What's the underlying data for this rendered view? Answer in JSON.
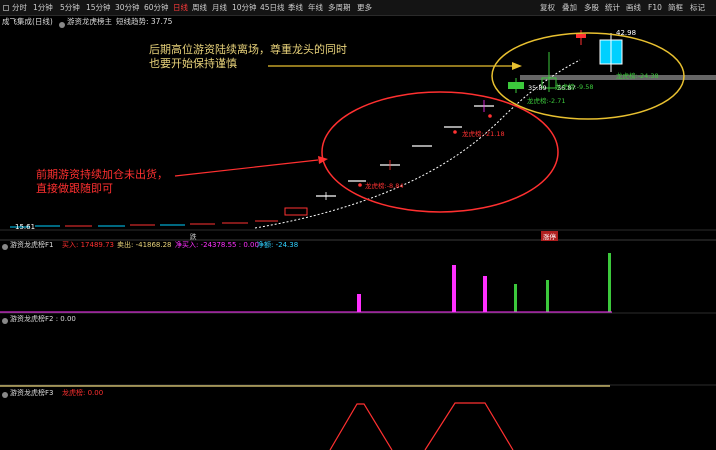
{
  "toolbar": {
    "periods": [
      "分时",
      "1分钟",
      "5分钟",
      "15分钟",
      "30分钟",
      "60分钟",
      "日线",
      "周线",
      "月线",
      "10分钟",
      "45日线",
      "季线",
      "年线",
      "多周期",
      "更多"
    ],
    "active_period": "日线",
    "right_buttons": [
      "复权",
      "叠加",
      "多股",
      "统计",
      "画线",
      "F10",
      "简框",
      "标记"
    ]
  },
  "info": {
    "stock": "成飞集成(日线)",
    "indicator": "游资龙虎榜主",
    "short_trend": "短线趋势: 37.75"
  },
  "main_chart": {
    "annotation_top_line1": "后期高位游资陆续离场，尊重龙头的同时",
    "annotation_top_line2": "也要开始保持谨慎",
    "annotation_left_line1": "前期游资持续加仓未出货，",
    "annotation_left_line2": "直接做跟随即可",
    "price_high": "42.98",
    "price_low": "35.89",
    "price_low2": "36.87",
    "label_left_price": "15.61",
    "dragon_label": "龙虎榜",
    "dragon_values": [
      "-8.84",
      "-21.18",
      "-24.38",
      "-9.58",
      "-2.71"
    ],
    "dragon_labels_full": [
      "龙虎榜:-8.84",
      "龙虎榜:-21.18",
      "龙虎榜:-24.38",
      "龙虎榜:-9.58",
      "龙虎榜:-2.71"
    ],
    "axis_mark": "涨停",
    "axis_mark2": "跌",
    "colors": {
      "up": "#ff3232",
      "down": "#00d0ff",
      "buy_line": "#ffffff",
      "support": "#777777"
    }
  },
  "panel_f1": {
    "title": "游资龙虎榜F1",
    "buy": "买入: 17489.73",
    "sell": "卖出: -41868.28",
    "net_buy": "净买入: -24378.55 : 0.00",
    "net_amount": "净额: -24.38",
    "colors": {
      "buy": "#ff3030",
      "sell": "#e8d27a",
      "net_buy": "#ff30ff",
      "net": "#30d0ff",
      "bar_pos": "#ff30ff",
      "bar_neg": "#3cc83c"
    }
  },
  "panel_f2": {
    "title": "游资龙虎榜F2 : 0.00"
  },
  "panel_f3": {
    "title": "游资龙虎榜F3",
    "value": "龙虎榜: 0.00"
  }
}
